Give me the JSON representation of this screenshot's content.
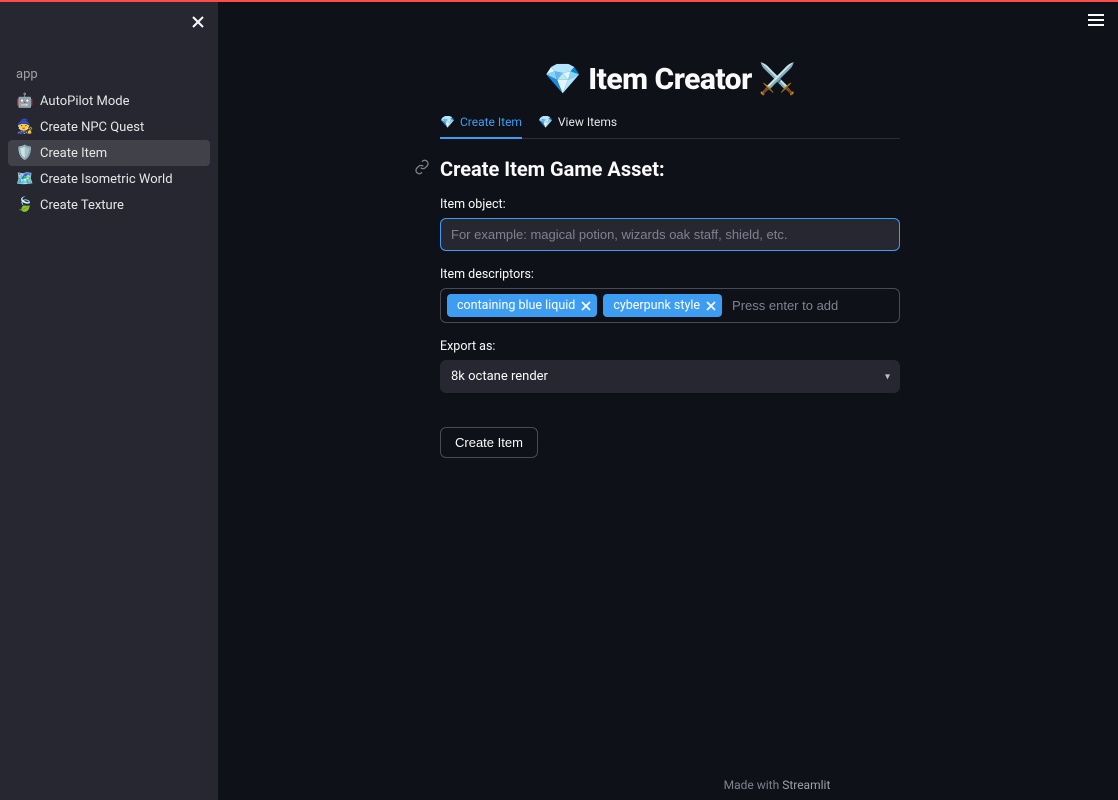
{
  "sidebar": {
    "heading": "app",
    "items": [
      {
        "icon": "🤖",
        "label": "AutoPilot Mode",
        "active": false
      },
      {
        "icon": "🧙",
        "label": "Create NPC Quest",
        "active": false
      },
      {
        "icon": "🛡️",
        "label": "Create Item",
        "active": true
      },
      {
        "icon": "🗺️",
        "label": "Create Isometric World",
        "active": false
      },
      {
        "icon": "🍃",
        "label": "Create Texture",
        "active": false
      }
    ]
  },
  "header": {
    "title": "💎 Item Creator ⚔️"
  },
  "tabs": [
    {
      "icon": "💎",
      "label": "Create Item",
      "active": true
    },
    {
      "icon": "💎",
      "label": "View Items",
      "active": false
    }
  ],
  "section": {
    "title": "Create Item Game Asset:"
  },
  "form": {
    "item_object": {
      "label": "Item object:",
      "value": "",
      "placeholder": "For example: magical potion, wizards oak staff, shield, etc."
    },
    "item_descriptors": {
      "label": "Item descriptors:",
      "tags": [
        "containing blue liquid",
        "cyberpunk style"
      ],
      "placeholder": "Press enter to add"
    },
    "export_as": {
      "label": "Export as:",
      "value": "8k octane render"
    },
    "submit_label": "Create Item"
  },
  "footer": {
    "prefix": "Made with ",
    "link": "Streamlit"
  }
}
